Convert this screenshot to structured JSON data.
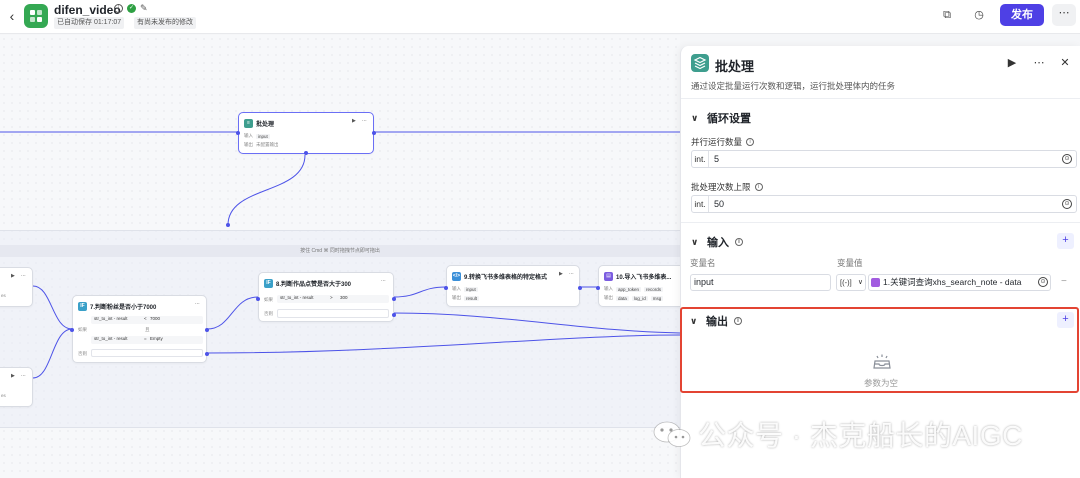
{
  "header": {
    "app_title": "difen_video",
    "autosave": "已自动保存 01:17:07",
    "unpublished": "有尚未发布的修改",
    "publish_label": "发布"
  },
  "canvas": {
    "loop_hint": "按住 Cmd ⌘ 同时拖拽节点即可拖出",
    "batch_node": {
      "title": "批处理",
      "input_label": "输入",
      "input_chip": "input",
      "output_label": "输出",
      "output_value": "未配置输出"
    },
    "node7": {
      "title": "7.判断粉丝是否小于7000",
      "if_label": "如果",
      "cond1_var": "str_to_int - result",
      "cond1_op": "<",
      "cond1_val": "7000",
      "join": "且",
      "cond2_var": "str_to_int - result",
      "cond2_op": "=",
      "cond2_val": "Empty",
      "else_label": "否则"
    },
    "node8": {
      "title": "8.判断作品点赞是否大于300",
      "if_label": "如果",
      "cond1_var": "str_to_int - result",
      "cond1_op": ">",
      "cond1_val": "300",
      "else_label": "否则"
    },
    "node9": {
      "title": "9.转换飞书多维表格的特定格式",
      "in_label": "输入",
      "in_chip": "input",
      "out_label": "输出",
      "out_chip": "result"
    },
    "node10": {
      "title": "10.导入飞书多维表...",
      "in_label": "输入",
      "chips_in": [
        "app_token",
        "records"
      ],
      "out_label": "输出",
      "chips_out": [
        "data",
        "log_id",
        "msg"
      ]
    },
    "left_label_a": "es",
    "left_label_b": "es"
  },
  "panel": {
    "title": "批处理",
    "description": "通过设定批量运行次数和逻辑，运行批处理体内的任务",
    "loop_section": "循环设置",
    "concurrency_label": "并行运行数量",
    "concurrency_prefix": "int.",
    "concurrency_value": "5",
    "limit_label": "批处理次数上限",
    "limit_prefix": "int.",
    "limit_value": "50",
    "input_section": "输入",
    "col_name": "变量名",
    "col_value": "变量值",
    "var_name": "input",
    "var_type": "[(-)]",
    "var_ref": "1.关键词查询xhs_search_note - data",
    "output_section": "输出",
    "empty_text": "参数为空"
  },
  "watermark": "公众号 · 杰克船长的AIGC",
  "colors": {
    "accent": "#4e40e5",
    "highlight_border": "#e34433",
    "wire": "#4d53e8"
  }
}
